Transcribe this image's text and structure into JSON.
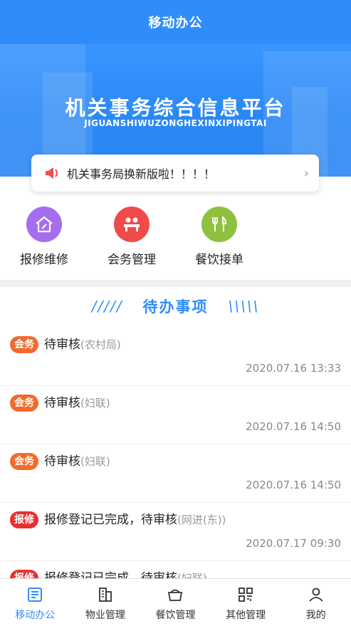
{
  "header": {
    "title": "移动办公"
  },
  "hero": {
    "title": "机关事务综合信息平台",
    "subtitle": "JIGUANSHIWUZONGHEXINXIPINGTAI"
  },
  "notice": {
    "text": "机关事务局换新版啦！！！！",
    "icon": "megaphone-icon"
  },
  "quick_actions": [
    {
      "label": "报修维修",
      "icon": "house-repair-icon",
      "color": "#a56df0"
    },
    {
      "label": "会务管理",
      "icon": "meeting-icon",
      "color": "#ef4b4b"
    },
    {
      "label": "餐饮接单",
      "icon": "cutlery-icon",
      "color": "#8fc13f"
    }
  ],
  "section": {
    "left_deco": "/////",
    "title": "待办事项",
    "right_deco": "\\\\\\\\\\"
  },
  "todos": [
    {
      "tag": "会务",
      "tag_color": "#f06c2c",
      "title": "待审核",
      "unit": "(农村局)",
      "time": "2020.07.16 13:33"
    },
    {
      "tag": "会务",
      "tag_color": "#f06c2c",
      "title": "待审核",
      "unit": "(妇联)",
      "time": "2020.07.16 14:50"
    },
    {
      "tag": "会务",
      "tag_color": "#f06c2c",
      "title": "待审核",
      "unit": "(妇联)",
      "time": "2020.07.16 14:50"
    },
    {
      "tag": "报修",
      "tag_color": "#e8302f",
      "title": "报修登记已完成，待审核",
      "unit": "(网进(东))",
      "time": "2020.07.17 09:30"
    },
    {
      "tag": "报修",
      "tag_color": "#e8302f",
      "title": "报修登记已完成，待审核",
      "unit": "(妇联)",
      "time": ""
    }
  ],
  "bottom_nav": [
    {
      "label": "移动办公",
      "icon": "office-icon",
      "active": true
    },
    {
      "label": "物业管理",
      "icon": "property-icon",
      "active": false
    },
    {
      "label": "餐饮管理",
      "icon": "dining-icon",
      "active": false
    },
    {
      "label": "其他管理",
      "icon": "qr-grid-icon",
      "active": false
    },
    {
      "label": "我的",
      "icon": "user-icon",
      "active": false
    }
  ],
  "colors": {
    "primary": "#2f8dfb"
  }
}
